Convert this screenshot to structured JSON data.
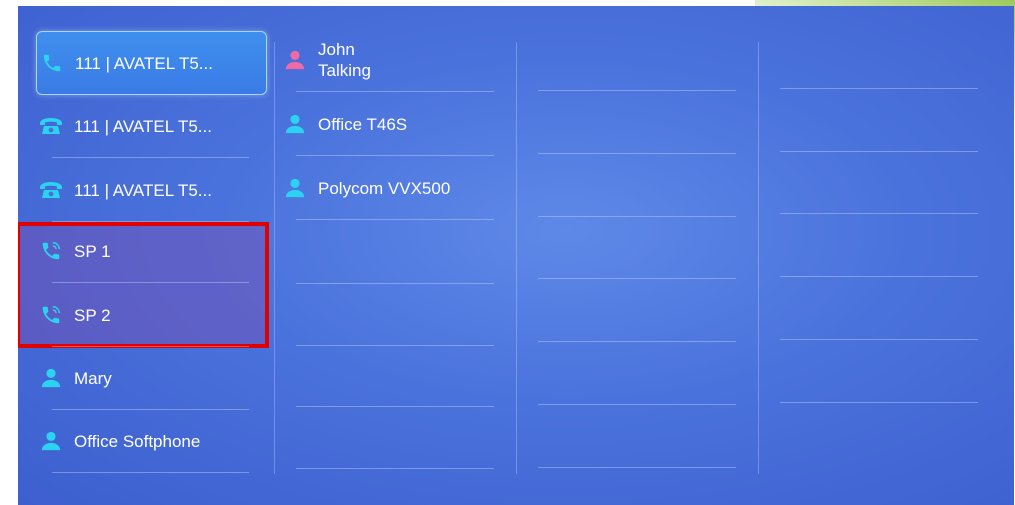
{
  "columns": [
    {
      "keys": [
        {
          "label": "111 | AVATEL T5...",
          "icon": "phone-handset-icon",
          "selected": true
        },
        {
          "label": "111 | AVATEL T5...",
          "icon": "desk-phone-icon"
        },
        {
          "label": "111 | AVATEL T5...",
          "icon": "desk-phone-icon"
        },
        {
          "label": "SP 1",
          "icon": "speed-dial-phone-icon"
        },
        {
          "label": "SP 2",
          "icon": "speed-dial-phone-icon"
        },
        {
          "label": "Mary",
          "icon": "contact-person-icon"
        },
        {
          "label": "Office Softphone",
          "icon": "contact-person-icon"
        }
      ]
    },
    {
      "keys": [
        {
          "label": "John",
          "status": "Talking",
          "icon": "contact-person-pink-icon"
        },
        {
          "label": "Office T46S",
          "icon": "contact-person-icon"
        },
        {
          "label": "Polycom VVX500",
          "icon": "contact-person-icon"
        }
      ]
    }
  ],
  "colors": {
    "background": "#4a72dc",
    "selected": "#3a7be6",
    "icon_cyan": "#2bd3f0",
    "icon_pink": "#f06aa6",
    "highlight_border": "#e00000"
  }
}
